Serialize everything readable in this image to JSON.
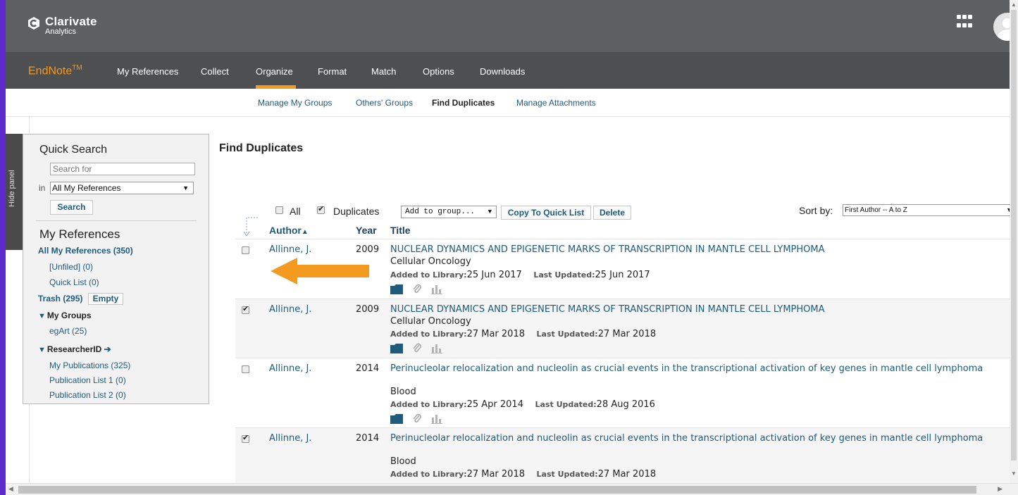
{
  "brand": {
    "company": "Clarivate",
    "company_sub": "Analytics",
    "product": "EndNote",
    "product_tm": "TM"
  },
  "nav": {
    "items": [
      "My References",
      "Collect",
      "Organize",
      "Format",
      "Match",
      "Options",
      "Downloads"
    ],
    "active": "Organize"
  },
  "subnav": {
    "items": [
      "Manage My Groups",
      "Others' Groups",
      "Find Duplicates",
      "Manage Attachments"
    ],
    "active": "Find Duplicates"
  },
  "hide_panel_label": "Hide panel",
  "sidebar": {
    "quick_search_title": "Quick Search",
    "search_placeholder": "Search for",
    "in_label": "in",
    "scope_value": "All My References",
    "search_button": "Search",
    "my_references_title": "My References",
    "all_refs": "All My References (350)",
    "unfiled": "[Unfiled] (0)",
    "quick_list": "Quick List (0)",
    "trash": "Trash (295)",
    "empty_button": "Empty",
    "my_groups": "My Groups",
    "group_egart": "egArt (25)",
    "researcher_id": "ResearcherID",
    "my_publications": "My Publications (325)",
    "pub_list_1": "Publication List 1 (0)",
    "pub_list_2": "Publication List 2 (0)"
  },
  "main": {
    "title": "Find Duplicates",
    "toolbar": {
      "all_label": "All",
      "duplicates_label": "Duplicates",
      "duplicates_checked": true,
      "add_to_group": "Add to group...",
      "copy_quick_list": "Copy To Quick List",
      "delete": "Delete",
      "sort_by_label": "Sort by:",
      "sort_value": "First Author -- A to Z"
    },
    "columns": {
      "author": "Author",
      "year": "Year",
      "title": "Title"
    },
    "rows": [
      {
        "checked": false,
        "author": "Allinne, J.",
        "year": "2009",
        "title": "NUCLEAR DYNAMICS AND EPIGENETIC MARKS OF TRANSCRIPTION IN MANTLE CELL LYMPHOMA",
        "journal": "Cellular Oncology",
        "added_label": "Added to Library:",
        "added": "25 Jun 2017",
        "updated_label": "Last Updated:",
        "updated": "25 Jun 2017"
      },
      {
        "checked": true,
        "author": "Allinne, J.",
        "year": "2009",
        "title": "NUCLEAR DYNAMICS AND EPIGENETIC MARKS OF TRANSCRIPTION IN MANTLE CELL LYMPHOMA",
        "journal": "Cellular Oncology",
        "added_label": "Added to Library:",
        "added": "27 Mar 2018",
        "updated_label": "Last Updated:",
        "updated": "27 Mar 2018"
      },
      {
        "checked": false,
        "author": "Allinne, J.",
        "year": "2014",
        "title": "Perinucleolar relocalization and nucleolin as crucial events in the transcriptional activation of key genes in mantle cell lymphoma",
        "journal": "Blood",
        "added_label": "Added to Library:",
        "added": "25 Apr 2014",
        "updated_label": "Last Updated:",
        "updated": "28 Aug 2016"
      },
      {
        "checked": true,
        "author": "Allinne, J.",
        "year": "2014",
        "title": "Perinucleolar relocalization and nucleolin as crucial events in the transcriptional activation of key genes in mantle cell lymphoma",
        "journal": "Blood",
        "added_label": "Added to Library:",
        "added": "27 Mar 2018",
        "updated_label": "Last Updated:",
        "updated": "27 Mar 2018"
      }
    ]
  },
  "colors": {
    "accent": "#f39a1f",
    "link": "#1e5b7d",
    "topbar": "#5e5f61",
    "navbar": "#4e4f51",
    "frame": "#5b2ac9"
  }
}
